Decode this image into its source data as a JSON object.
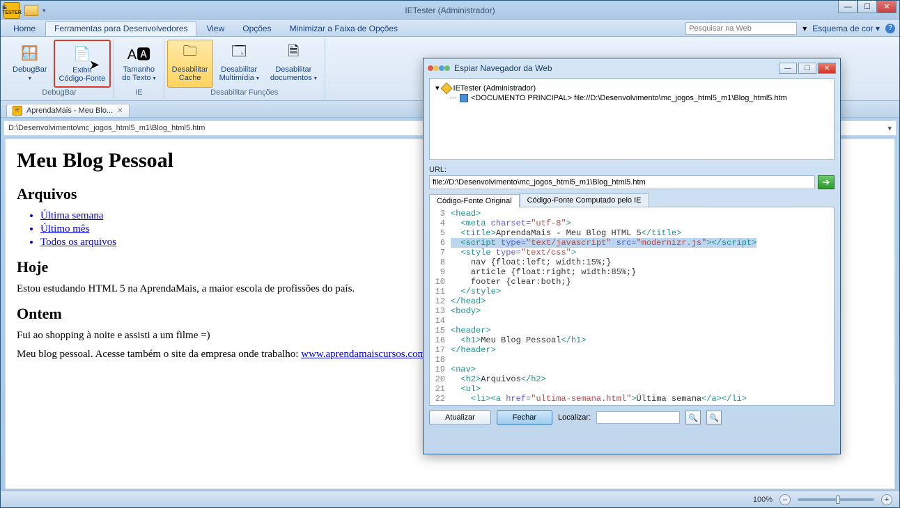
{
  "window": {
    "title": "IETester (Administrador)",
    "qat_badge": "IE TESTER"
  },
  "menubar": {
    "tabs": [
      "Home",
      "Ferramentas para Desenvolvedores",
      "View",
      "Opções",
      "Minimizar a Faixa de Opções"
    ],
    "active_index": 1,
    "search_placeholder": "Pesquisar na Web",
    "scheme_label": "Esquema de cor"
  },
  "ribbon": {
    "groups": [
      {
        "label": "DebugBar",
        "items": [
          {
            "name": "debugbar",
            "line1": "DebugBar",
            "line2": "",
            "dd": true,
            "icon": "🪟"
          },
          {
            "name": "exibir-codigo",
            "line1": "Exibir",
            "line2": "Código-Fonte",
            "dd": false,
            "icon": "📄",
            "selected": true
          }
        ]
      },
      {
        "label": "IE",
        "items": [
          {
            "name": "tamanho-texto",
            "line1": "Tamanho",
            "line2": "do Texto",
            "dd": true,
            "icon": "A🅰"
          }
        ]
      },
      {
        "label": "Desabilitar Funções",
        "items": [
          {
            "name": "desabilitar-cache",
            "line1": "Desabilitar",
            "line2": "Cache",
            "dd": false,
            "icon": "🗀",
            "active": true
          },
          {
            "name": "desabilitar-multimidia",
            "line1": "Desabilitar",
            "line2": "Multimídia",
            "dd": true,
            "icon": "🗔"
          },
          {
            "name": "desabilitar-documentos",
            "line1": "Desabilitar",
            "line2": "documentos",
            "dd": true,
            "icon": "🗎"
          }
        ]
      }
    ]
  },
  "doc_tab": {
    "title": "AprendaMais - Meu Blo..."
  },
  "address": "D:\\Desenvolvimento\\mc_jogos_html5_m1\\Blog_html5.htm",
  "page": {
    "h1": "Meu Blog Pessoal",
    "nav_heading": "Arquivos",
    "nav_items": [
      "Última semana",
      "Último mês",
      "Todos os arquivos"
    ],
    "hoje_heading": "Hoje",
    "hoje_text": "Estou estudando HTML 5 na AprendaMais, a maior escola de profissões do país.",
    "ontem_heading": "Ontem",
    "ontem_text": "Fui ao shopping à noite e assisti a um filme =)",
    "footer_prefix": "Meu blog pessoal. Acesse também o site da empresa onde trabalho: ",
    "footer_link": "www.aprendamaiscursos.com.br"
  },
  "statusbar": {
    "zoom": "100%"
  },
  "dialog": {
    "title": "Espiar Navegador da Web",
    "tree_root": "IETester (Administrador)",
    "tree_doc": "<DOCUMENTO PRINCIPAL> file://D:\\Desenvolvimento\\mc_jogos_html5_m1\\Blog_html5.htm",
    "url_label": "URL:",
    "url_value": "file://D:\\Desenvolvimento\\mc_jogos_html5_m1\\Blog_html5.htm",
    "tabs": [
      "Código-Fonte Original",
      "Código-Fonte Computado pelo IE"
    ],
    "code_lines": [
      {
        "n": 3,
        "html": "<span class='c-tag'>&lt;head&gt;</span>"
      },
      {
        "n": 4,
        "html": "  <span class='c-tag'>&lt;meta</span> <span class='c-attr'>charset=</span><span class='c-str'>\"utf-8\"</span><span class='c-tag'>&gt;</span>"
      },
      {
        "n": 5,
        "html": "  <span class='c-tag'>&lt;title&gt;</span><span class='c-txt'>AprendaMais - Meu Blog HTML 5</span><span class='c-tag'>&lt;/title&gt;</span>"
      },
      {
        "n": 6,
        "hl": true,
        "html": "  <span class='c-tag'>&lt;script</span> <span class='c-attr'>type=</span><span class='c-str'>\"text/javascript\"</span> <span class='c-attr'>src=</span><span class='c-str'>\"modernizr.js\"</span><span class='c-tag'>&gt;&lt;/script&gt;</span>"
      },
      {
        "n": 7,
        "html": "  <span class='c-tag'>&lt;style</span> <span class='c-attr'>type=</span><span class='c-str'>\"text/css\"</span><span class='c-tag'>&gt;</span>"
      },
      {
        "n": 8,
        "html": "    <span class='c-txt'>nav {float:left; width:15%;}</span>"
      },
      {
        "n": 9,
        "html": "    <span class='c-txt'>article {float:right; width:85%;}</span>"
      },
      {
        "n": 10,
        "html": "    <span class='c-txt'>footer {clear:both;}</span>"
      },
      {
        "n": 11,
        "html": "  <span class='c-tag'>&lt;/style&gt;</span>"
      },
      {
        "n": 12,
        "html": "<span class='c-tag'>&lt;/head&gt;</span>"
      },
      {
        "n": 13,
        "html": "<span class='c-tag'>&lt;body&gt;</span>"
      },
      {
        "n": 14,
        "html": ""
      },
      {
        "n": 15,
        "html": "<span class='c-tag'>&lt;header&gt;</span>"
      },
      {
        "n": 16,
        "html": "  <span class='c-tag'>&lt;h1&gt;</span><span class='c-txt'>Meu Blog Pessoal</span><span class='c-tag'>&lt;/h1&gt;</span>"
      },
      {
        "n": 17,
        "html": "<span class='c-tag'>&lt;/header&gt;</span>"
      },
      {
        "n": 18,
        "html": ""
      },
      {
        "n": 19,
        "html": "<span class='c-tag'>&lt;nav&gt;</span>"
      },
      {
        "n": 20,
        "html": "  <span class='c-tag'>&lt;h2&gt;</span><span class='c-txt'>Arquivos</span><span class='c-tag'>&lt;/h2&gt;</span>"
      },
      {
        "n": 21,
        "html": "  <span class='c-tag'>&lt;ul&gt;</span>"
      },
      {
        "n": 22,
        "html": "    <span class='c-tag'>&lt;li&gt;&lt;a</span> <span class='c-attr'>href=</span><span class='c-str'>\"ultima-semana.html\"</span><span class='c-tag'>&gt;</span><span class='c-txt'>Última semana</span><span class='c-tag'>&lt;/a&gt;&lt;/li&gt;</span>"
      }
    ],
    "btn_update": "Atualizar",
    "btn_close": "Fechar",
    "find_label": "Localizar:"
  }
}
